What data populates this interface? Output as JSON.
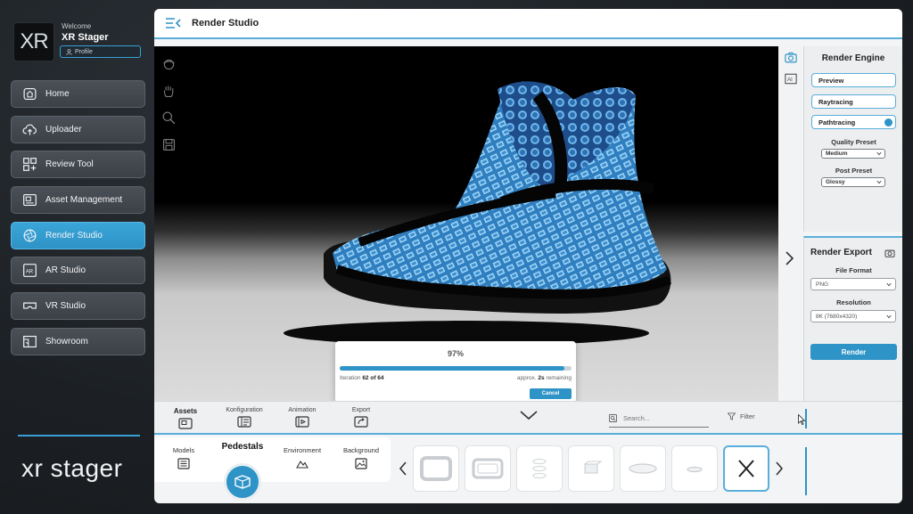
{
  "sidebar": {
    "logo_text": "XR",
    "welcome": "Welcome",
    "user_name": "XR Stager",
    "profile_label": "Profile",
    "items": [
      {
        "label": "Home",
        "icon": "home-icon"
      },
      {
        "label": "Uploader",
        "icon": "cloud-upload-icon"
      },
      {
        "label": "Review Tool",
        "icon": "grid-plus-icon"
      },
      {
        "label": "Asset Management",
        "icon": "asset-icon"
      },
      {
        "label": "Render Studio",
        "icon": "aperture-icon",
        "active": true
      },
      {
        "label": "AR Studio",
        "icon": "ar-icon"
      },
      {
        "label": "VR Studio",
        "icon": "vr-headset-icon"
      },
      {
        "label": "Showroom",
        "icon": "showroom-icon"
      }
    ],
    "brand": "xr stager"
  },
  "header": {
    "title": "Render Studio"
  },
  "render_engine": {
    "title": "Render Engine",
    "modes": [
      "Preview",
      "Raytracing",
      "Pathtracing"
    ],
    "selected_mode": "Pathtracing",
    "quality_label": "Quality Preset",
    "quality_value": "Medium",
    "post_label": "Post Preset",
    "post_value": "Glossy"
  },
  "render_export": {
    "title": "Render Export",
    "format_label": "File Format",
    "format_value": "PNG",
    "resolution_label": "Resolution",
    "resolution_value": "8K (7680x4320)",
    "render_label": "Render"
  },
  "progress": {
    "percent_label": "97%",
    "percent": 0.97,
    "iteration_prefix": "Iteration",
    "iteration_value": "62 of 64",
    "remaining_prefix": "approx.",
    "remaining_value": "2s",
    "remaining_suffix": "remaining",
    "cancel_label": "Cancel"
  },
  "bottom_tabs": [
    "Assets",
    "Konfiguration",
    "Animation",
    "Export"
  ],
  "active_tab": "Assets",
  "search": {
    "placeholder": "Search..."
  },
  "filter_label": "Filter",
  "categories": [
    "Models",
    "Pedestals",
    "Environment",
    "Background"
  ],
  "active_category": "Pedestals",
  "colors": {
    "accent": "#2e93c6",
    "sidebar_item": "#474c52",
    "panel": "#eceeef"
  }
}
